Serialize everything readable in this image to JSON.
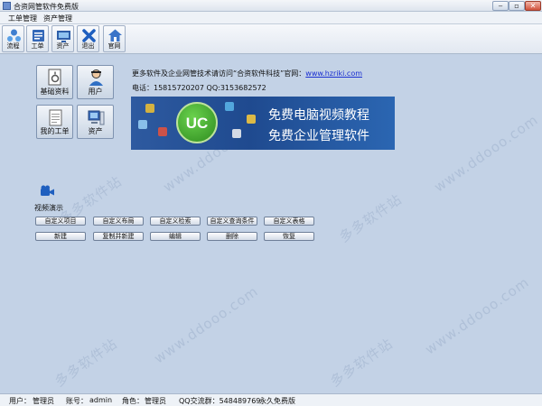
{
  "window": {
    "title": "合资网管软件免费版",
    "minimize": "‒",
    "maximize": "▫",
    "close": "✕"
  },
  "menu": [
    "工单管理",
    "资产管理"
  ],
  "toolbar": [
    {
      "label": "流程",
      "icon": "workflow-icon"
    },
    {
      "label": "工单",
      "icon": "ticket-icon"
    },
    {
      "label": "资产",
      "icon": "asset-icon"
    },
    {
      "label": "退出",
      "icon": "exit-icon"
    },
    {
      "label": "官网",
      "icon": "home-icon"
    }
  ],
  "modules": {
    "basic": "基础资料",
    "user": "用户",
    "my_ticket": "我的工单",
    "asset": "资产"
  },
  "info": {
    "prefix": "更多软件及企业网管技术请访问“合资软件科技”官网：",
    "link": "www.hzriki.com",
    "contact": "电话：15815720207  QQ:3153682572"
  },
  "banner": {
    "logo_text": "UC",
    "line1": "免费电脑视频教程",
    "line2": "免费企业管理软件"
  },
  "video": {
    "label": "视频演示"
  },
  "actions_row1": [
    "自定义项目",
    "自定义布局",
    "自定义检索",
    "自定义查询条件",
    "自定义表格"
  ],
  "actions_row2": [
    "新建",
    "复制并新建",
    "编辑",
    "删除",
    "恢复"
  ],
  "status": {
    "user_label": "用户：",
    "user_value": "管理员",
    "account_label": "账号：",
    "account_value": "admin",
    "role_label": "角色：",
    "role_value": "管理员",
    "qq_group": "QQ交流群：548489769",
    "edition": "永久免费版"
  },
  "watermark": [
    "多多软件站",
    "www.ddooo.com"
  ],
  "colors": {
    "background": "#c3d2e6",
    "banner": "#1f4a8f",
    "link": "#1a2fd1"
  }
}
